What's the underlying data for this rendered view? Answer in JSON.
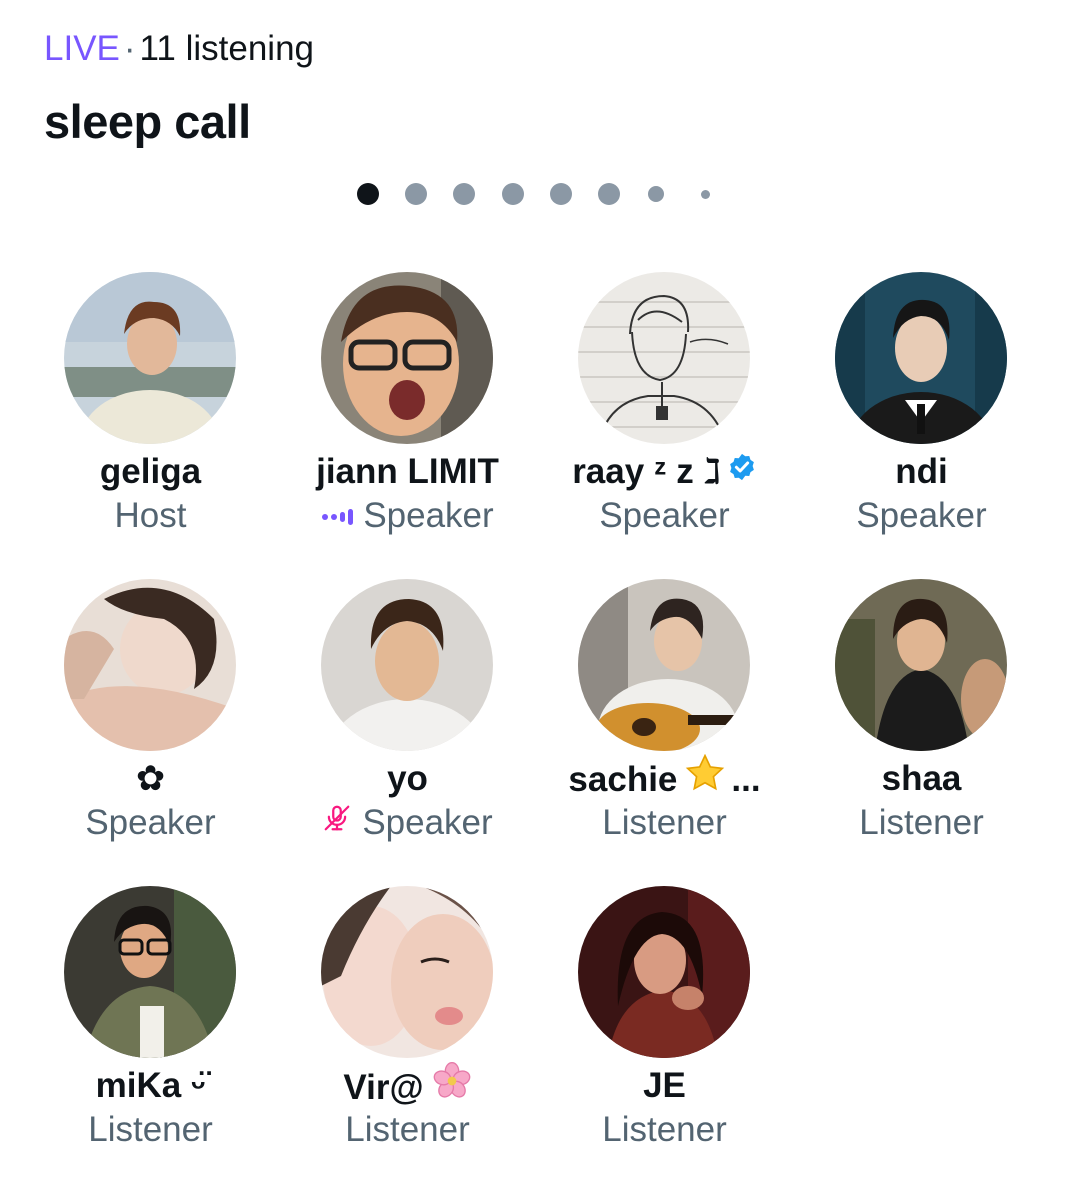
{
  "header": {
    "live_label": "LIVE",
    "separator": "·",
    "listening_label": "11 listening"
  },
  "space": {
    "title": "sleep call"
  },
  "pager": {
    "total_dots": 8,
    "active_index": 0
  },
  "colors": {
    "live": "#7856ff",
    "muted_text": "#536471",
    "primary_text": "#0f1419",
    "verified": "#1d9bf0",
    "muted_mic": "#f91880",
    "speaking": "#7856ff"
  },
  "participants": [
    {
      "name": "geliga",
      "role": "Host",
      "status_icon": "",
      "badge": ""
    },
    {
      "name": "jiann LIMIT",
      "role": "Speaker",
      "status_icon": "speaking-icon",
      "badge": ""
    },
    {
      "name": "raay ᶻ z ℷ",
      "role": "Speaker",
      "status_icon": "",
      "badge": "verified-badge-icon"
    },
    {
      "name": "ndi",
      "role": "Speaker",
      "status_icon": "",
      "badge": ""
    },
    {
      "name": "✿",
      "role": "Speaker",
      "status_icon": "",
      "badge": ""
    },
    {
      "name": "yo",
      "role": "Speaker",
      "status_icon": "muted-mic-icon",
      "badge": ""
    },
    {
      "name": "sachie",
      "name_suffix": "...",
      "role": "Listener",
      "status_icon": "",
      "badge": "star-emoji-icon"
    },
    {
      "name": "shaa",
      "role": "Listener",
      "status_icon": "",
      "badge": ""
    },
    {
      "name": "miKa ᵕ̈ ",
      "role": "Listener",
      "status_icon": "",
      "badge": ""
    },
    {
      "name": "Vir@",
      "role": "Listener",
      "status_icon": "",
      "badge": "cherry-blossom-emoji-icon"
    },
    {
      "name": "JE",
      "role": "Listener",
      "status_icon": "",
      "badge": ""
    }
  ]
}
